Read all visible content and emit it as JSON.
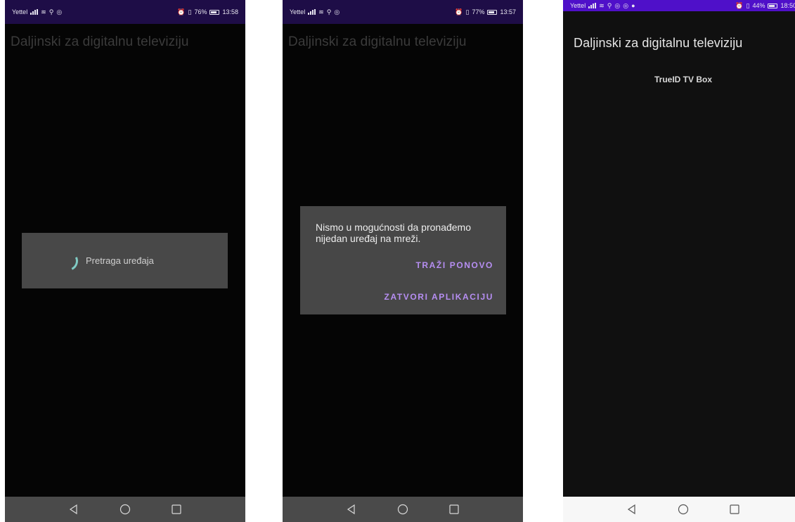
{
  "screens": [
    {
      "status": {
        "carrier": "Yettel",
        "battery": "76%",
        "time": "13:58"
      },
      "app_title": "Daljinski za digitalnu televiziju",
      "progress_dialog": {
        "message": "Pretraga uređaja"
      }
    },
    {
      "status": {
        "carrier": "Yettel",
        "battery": "77%",
        "time": "13:57"
      },
      "app_title": "Daljinski za digitalnu televiziju",
      "alert_dialog": {
        "message": "Nismo u mogućnosti da pronađemo nijedan uređaj na mreži.",
        "retry_label": "TRAŽI PONOVO",
        "close_label": "ZATVORI APLIKACIJU"
      }
    },
    {
      "status": {
        "carrier": "Yettel",
        "battery": "44%",
        "time": "18:50"
      },
      "app_title": "Daljinski za digitalnu televiziju",
      "devices": [
        "TrueID TV Box"
      ]
    }
  ],
  "icons": {
    "back": "back-triangle-icon",
    "home": "home-circle-icon",
    "recents": "recents-square-icon"
  },
  "colors": {
    "status_bar_dark": "#1e0d47",
    "status_bar_purple": "#4f10c9",
    "dialog_bg": "#484848",
    "dialog_button": "#b68ef2",
    "spinner": "#80cbc4"
  }
}
